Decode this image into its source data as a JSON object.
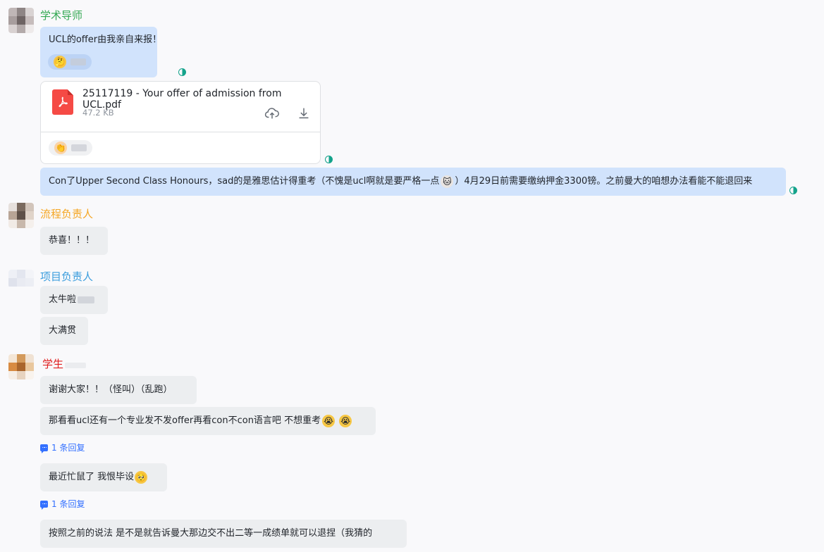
{
  "colors": {
    "tutor_name": "#34a853",
    "process_name": "#f5a623",
    "project_name": "#3b9ddd",
    "student_name": "#e02020",
    "bubble_self": "#d1e3fc",
    "bubble_other": "#eceef0",
    "reply_link": "#3370ff",
    "read_receipt": "#14a38b"
  },
  "messages": {
    "tutor": {
      "sender": "学术导师",
      "msg1": "UCL的offer由我亲自来报！",
      "file": {
        "name": "25117119 - Your offer of admission from UCL.pdf",
        "size": "47.2 KB",
        "icon": "pdf-icon",
        "upload_icon": "cloud-upload-icon",
        "download_icon": "download-icon"
      },
      "msg2": "Con了Upper Second Class Honours，sad的是雅思估计得重考（不愧是ucl啊就是要严格一点",
      "msg2_tail": "）4月29日前需要缴纳押金3300镑。之前曼大的咱想办法看能不能退回来"
    },
    "process": {
      "sender": "流程负责人",
      "msg1": "恭喜！！！"
    },
    "project": {
      "sender": "项目负责人",
      "msg1": "太牛啦",
      "msg2": "大满贯"
    },
    "student": {
      "sender": "学生",
      "msg1": "谢谢大家！！（怪叫）（乱跑）",
      "msg2": "那看看ucl还有一个专业发不发offer再看con不con语言吧 不想重考",
      "reply1": "1 条回复",
      "msg3": "最近忙鼠了 我恨毕设",
      "reply2": "1 条回复",
      "msg4": "按照之前的说法 是不是就告诉曼大那边交不出二等一成绩单就可以退捏（我猜的"
    }
  }
}
